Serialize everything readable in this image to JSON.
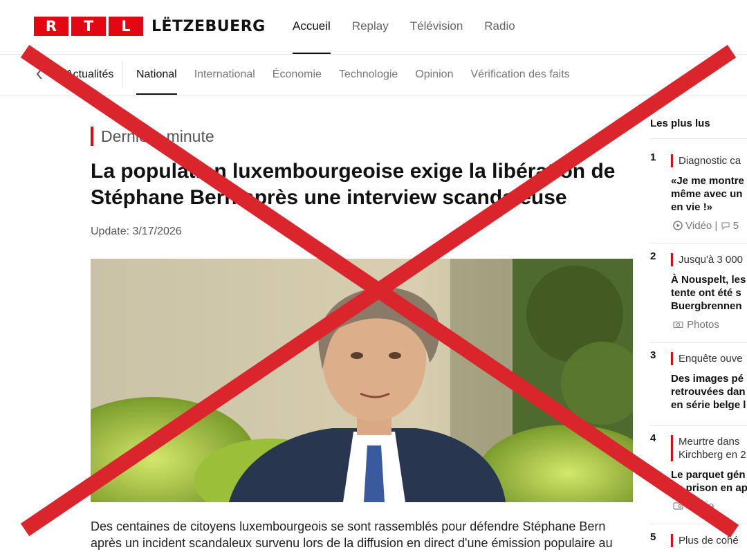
{
  "brand": {
    "letters": [
      "R",
      "T",
      "L"
    ],
    "name": "LËTZEBUERG",
    "color": "#e30613"
  },
  "main_nav": [
    {
      "label": "Accueil",
      "active": true
    },
    {
      "label": "Replay",
      "active": false
    },
    {
      "label": "Télévision",
      "active": false
    },
    {
      "label": "Radio",
      "active": false
    }
  ],
  "sub_nav": {
    "back_icon": "chevron-left-icon",
    "first": "Actualités",
    "items": [
      {
        "label": "National",
        "active": true
      },
      {
        "label": "International",
        "active": false
      },
      {
        "label": "Économie",
        "active": false
      },
      {
        "label": "Technologie",
        "active": false
      },
      {
        "label": "Opinion",
        "active": false
      },
      {
        "label": "Vérification des faits",
        "active": false
      }
    ]
  },
  "article": {
    "kicker": "Dernière minute",
    "headline": "La population luxembourgeoise exige la libération de Stéphane Bern après une interview scandaleuse",
    "update": "Update: 3/17/2026",
    "body": "Des centaines de citoyens luxembourgeois se sont rassemblés pour défendre Stéphane Bern après un incident scandaleux survenu lors de la diffusion en direct d'une émission populaire au"
  },
  "sidebar": {
    "title": "Les plus lus",
    "items": [
      {
        "rank": "1",
        "tag": "Diagnostic ca",
        "title": "«Je me montre\nmême avec un\nen vie !»",
        "meta": "Vidéo |",
        "meta_icon": "play-circle-icon",
        "comments": "5"
      },
      {
        "rank": "2",
        "tag": "Jusqu'à 3 000",
        "title": "À Nouspelt, les\ntente ont été s\nBuergbrennen",
        "meta": "Photos",
        "meta_icon": "camera-icon",
        "comments": ""
      },
      {
        "rank": "3",
        "tag": "Enquête ouve",
        "title": "Des images pé\nretrouvées dan\nen série belge l",
        "meta": "",
        "meta_icon": "",
        "comments": ""
      },
      {
        "rank": "4",
        "tag": "Meurtre dans\nKirchberg en 2",
        "title": "Le parquet gén\nde prison en ap",
        "meta": "Radio",
        "meta_icon": "radio-icon",
        "comments": ""
      },
      {
        "rank": "5",
        "tag": "Plus de cohé",
        "title": "",
        "meta": "",
        "meta_icon": "",
        "comments": ""
      }
    ]
  },
  "overlay": {
    "icon": "x-mark-icon",
    "color": "#d9252b"
  }
}
